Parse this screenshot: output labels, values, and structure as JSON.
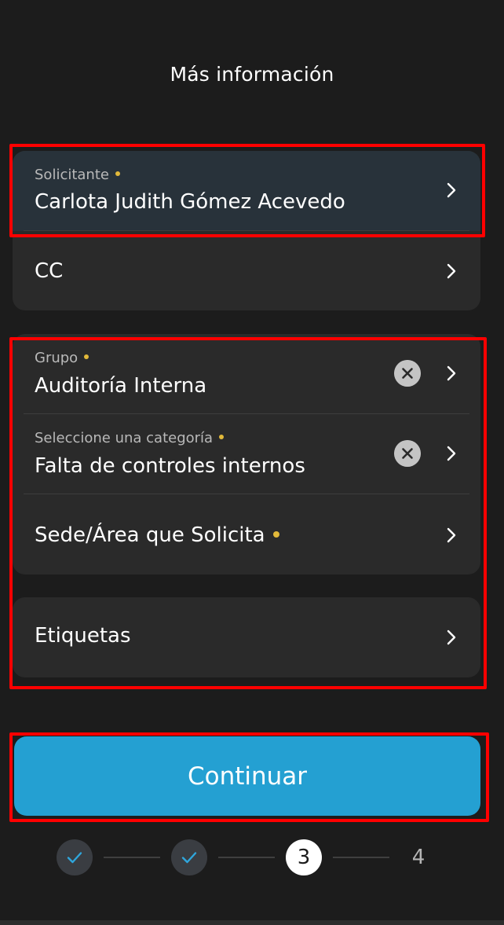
{
  "header": {
    "title": "Más información"
  },
  "section_people": {
    "solicitante": {
      "label": "Solicitante",
      "value": "Carlota Judith Gómez Acevedo",
      "required": true
    },
    "cc": {
      "label": "CC"
    }
  },
  "section_classification": {
    "grupo": {
      "label": "Grupo",
      "value": "Auditoría Interna",
      "required": true
    },
    "categoria": {
      "label": "Seleccione una categoría",
      "value": "Falta de controles internos",
      "required": true
    },
    "sede": {
      "label": "Sede/Área que Solicita",
      "required": true
    }
  },
  "section_tags": {
    "etiquetas": {
      "label": "Etiquetas"
    }
  },
  "actions": {
    "continue_label": "Continuar"
  },
  "stepper": {
    "current_step": "3",
    "next_step": "4",
    "total_steps": 4,
    "completed_steps": 2
  },
  "colors": {
    "background": "#1c1c1c",
    "card": "#2a2a2a",
    "accent": "#24a0d2",
    "required_dot": "#e2b93a",
    "annotation": "#ff0000"
  },
  "icons": {
    "chevron": "chevron-right-icon",
    "clear": "clear-icon",
    "check": "check-icon"
  }
}
